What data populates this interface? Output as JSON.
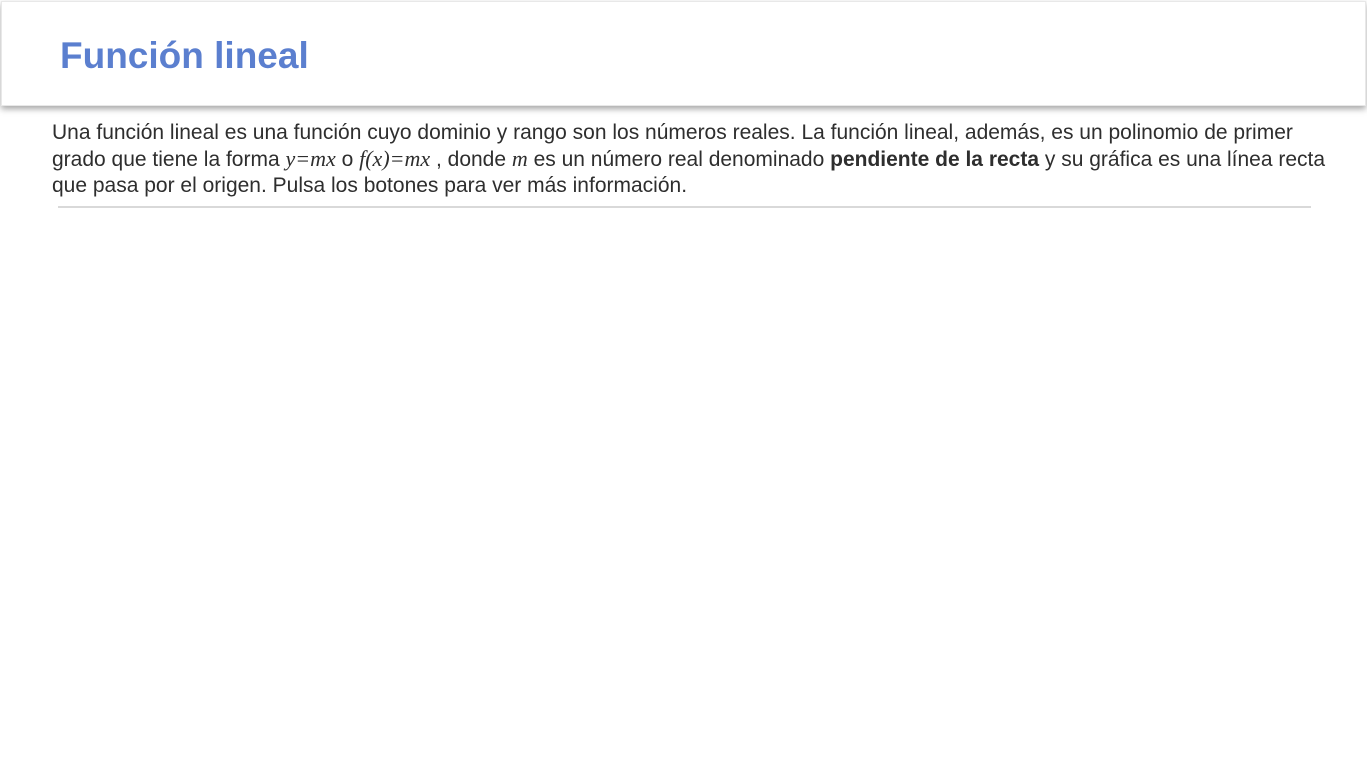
{
  "header": {
    "title": "Función lineal"
  },
  "intro": {
    "part1": "Una función lineal es una función cuyo dominio y rango son los números reales. La función lineal, además, es un polinomio de primer grado que tiene la forma ",
    "formula1": "y=mx",
    "connector": " o ",
    "formula2": "f(x)=mx",
    "part2": " , donde ",
    "variable_m": "m",
    "part3": " es un número real denominado ",
    "bold_term": "pendiente de la recta",
    "part4": " y su gráfica es una línea recta que pasa por el origen. Pulsa los botones para ver más información."
  },
  "colors": {
    "title": "#5b7fcf",
    "text": "#2e2e2e",
    "divider": "#d9d9d9"
  }
}
